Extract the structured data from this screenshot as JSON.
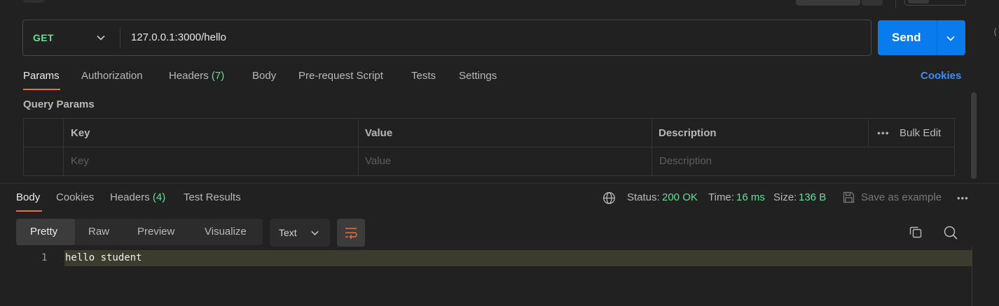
{
  "request": {
    "method": "GET",
    "url": "127.0.0.1:3000/hello",
    "send_label": "Send"
  },
  "request_tabs": {
    "params": "Params",
    "authorization": "Authorization",
    "headers": "Headers",
    "headers_count": "(7)",
    "body": "Body",
    "prerequest": "Pre-request Script",
    "tests": "Tests",
    "settings": "Settings",
    "cookies": "Cookies"
  },
  "query_params": {
    "title": "Query Params",
    "columns": {
      "key": "Key",
      "value": "Value",
      "description": "Description"
    },
    "bulk_edit": "Bulk Edit",
    "more": "•••",
    "placeholders": {
      "key": "Key",
      "value": "Value",
      "description": "Description"
    }
  },
  "response_tabs": {
    "body": "Body",
    "cookies": "Cookies",
    "headers": "Headers",
    "headers_count": "(4)",
    "test_results": "Test Results"
  },
  "response_meta": {
    "status_label": "Status:",
    "status_value": "200 OK",
    "time_label": "Time:",
    "time_value": "16 ms",
    "size_label": "Size:",
    "size_value": "136 B",
    "save_example": "Save as example",
    "more": "•••"
  },
  "view_modes": {
    "pretty": "Pretty",
    "raw": "Raw",
    "preview": "Preview",
    "visualize": "Visualize",
    "format": "Text"
  },
  "editor": {
    "lines": [
      {
        "number": "1",
        "text": "hello student"
      }
    ]
  },
  "colors": {
    "accent_tab": "#f26b3a",
    "send_button": "#097bed",
    "method_get": "#6bdd9a",
    "status_ok": "#6bdd9a",
    "link": "#3d8ef2"
  },
  "icons": [
    "chevron-down-icon",
    "globe-icon",
    "save-icon",
    "wrap-lines-icon",
    "copy-icon",
    "search-icon",
    "more-icon"
  ]
}
